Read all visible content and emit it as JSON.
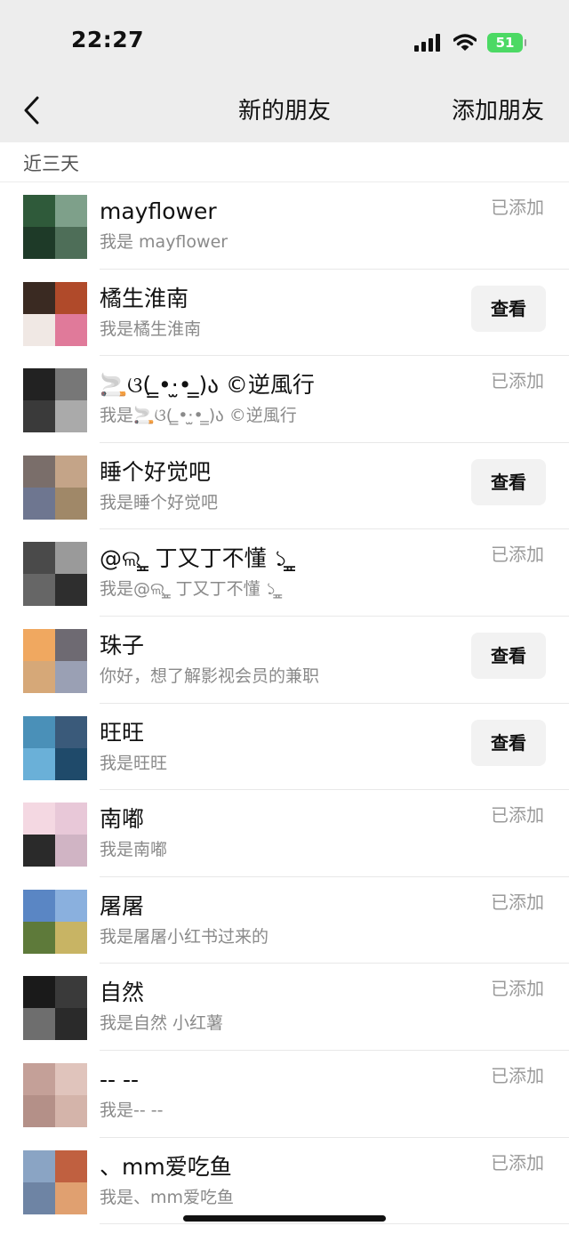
{
  "status_bar": {
    "time": "22:27",
    "battery": "51"
  },
  "nav": {
    "title": "新的朋友",
    "action": "添加朋友"
  },
  "section": {
    "header": "近三天"
  },
  "friends": [
    {
      "name": "mayflower",
      "greeting": "我是 mayflower",
      "status": "已添加",
      "action": "",
      "avatar_colors": [
        "#2f5a3a",
        "#7ea08a",
        "#1e3a28",
        "#4e6e58"
      ]
    },
    {
      "name": "橘生淮南",
      "greeting": "我是橘生淮南",
      "status": "",
      "action": "查看",
      "avatar_colors": [
        "#3a2a22",
        "#b04a2a",
        "#f0e8e4",
        "#e07a9a"
      ]
    },
    {
      "name": "🚬ଓ( ̳•·̫• ̳)ა ©逆風行",
      "greeting": "我是🚬ଓ( ̳•·̫• ̳)ა ©逆風行",
      "status": "已添加",
      "action": "",
      "avatar_colors": [
        "#222222",
        "#777777",
        "#3a3a3a",
        "#aaaaaa"
      ]
    },
    {
      "name": "睡个好觉吧",
      "greeting": "我是睡个好觉吧",
      "status": "",
      "action": "查看",
      "avatar_colors": [
        "#7a6e6a",
        "#c4a488",
        "#6e7690",
        "#a08868"
      ]
    },
    {
      "name": "@ଲ ̳͈ 丁又丁不懂 ১ ̳͈",
      "greeting": "我是@ଲ ̳͈ 丁又丁不懂 ১ ̳͈",
      "status": "已添加",
      "action": "",
      "avatar_colors": [
        "#4a4a4a",
        "#9a9a9a",
        "#666666",
        "#2e2e2e"
      ]
    },
    {
      "name": "珠子",
      "greeting": "你好，想了解影视会员的兼职",
      "status": "",
      "action": "查看",
      "avatar_colors": [
        "#f0a860",
        "#6e6a72",
        "#d6a878",
        "#9aa0b4"
      ]
    },
    {
      "name": "旺旺",
      "greeting": "我是旺旺",
      "status": "",
      "action": "查看",
      "avatar_colors": [
        "#4a90b8",
        "#3a5a7a",
        "#6ab0d8",
        "#1f4a6a"
      ]
    },
    {
      "name": "南嘟",
      "greeting": "我是南嘟",
      "status": "已添加",
      "action": "",
      "avatar_colors": [
        "#f4d8e2",
        "#e8c8d8",
        "#2a2a2a",
        "#d0b4c4"
      ]
    },
    {
      "name": "屠屠",
      "greeting": "我是屠屠小红书过来的",
      "status": "已添加",
      "action": "",
      "avatar_colors": [
        "#5a86c4",
        "#8ab0de",
        "#5e7a3a",
        "#c8b464"
      ]
    },
    {
      "name": "自然",
      "greeting": "我是自然 小红薯",
      "status": "已添加",
      "action": "",
      "avatar_colors": [
        "#1a1a1a",
        "#3a3a3a",
        "#6e6e6e",
        "#2a2a2a"
      ]
    },
    {
      "name": "-- --",
      "greeting": "我是-- --",
      "status": "已添加",
      "action": "",
      "avatar_colors": [
        "#c4a098",
        "#e0c4bc",
        "#b49088",
        "#d4b4aa"
      ]
    },
    {
      "name": "、mm爱吃鱼",
      "greeting": "我是、mm爱吃鱼",
      "status": "已添加",
      "action": "",
      "avatar_colors": [
        "#8aa4c4",
        "#c06040",
        "#6e84a4",
        "#e0a070"
      ]
    }
  ]
}
